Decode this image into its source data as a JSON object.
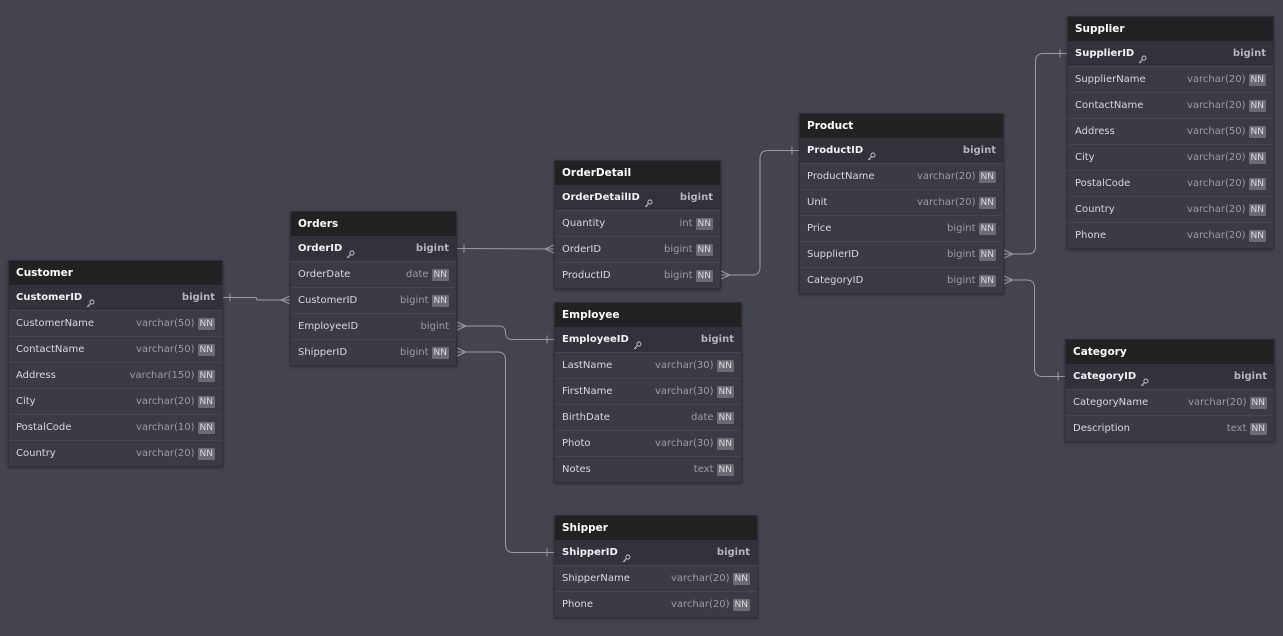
{
  "tables": {
    "customer": {
      "name": "Customer",
      "columns": [
        {
          "name": "CustomerID",
          "type": "bigint",
          "pk": true,
          "nn": false
        },
        {
          "name": "CustomerName",
          "type": "varchar(50)",
          "pk": false,
          "nn": true
        },
        {
          "name": "ContactName",
          "type": "varchar(50)",
          "pk": false,
          "nn": true
        },
        {
          "name": "Address",
          "type": "varchar(150)",
          "pk": false,
          "nn": true
        },
        {
          "name": "City",
          "type": "varchar(20)",
          "pk": false,
          "nn": true
        },
        {
          "name": "PostalCode",
          "type": "varchar(10)",
          "pk": false,
          "nn": true
        },
        {
          "name": "Country",
          "type": "varchar(20)",
          "pk": false,
          "nn": true
        }
      ]
    },
    "orders": {
      "name": "Orders",
      "columns": [
        {
          "name": "OrderID",
          "type": "bigint",
          "pk": true,
          "nn": false
        },
        {
          "name": "OrderDate",
          "type": "date",
          "pk": false,
          "nn": true
        },
        {
          "name": "CustomerID",
          "type": "bigint",
          "pk": false,
          "nn": true
        },
        {
          "name": "EmployeeID",
          "type": "bigint",
          "pk": false,
          "nn": false
        },
        {
          "name": "ShipperID",
          "type": "bigint",
          "pk": false,
          "nn": true
        }
      ]
    },
    "orderdetail": {
      "name": "OrderDetail",
      "columns": [
        {
          "name": "OrderDetailID",
          "type": "bigint",
          "pk": true,
          "nn": false
        },
        {
          "name": "Quantity",
          "type": "int",
          "pk": false,
          "nn": true
        },
        {
          "name": "OrderID",
          "type": "bigint",
          "pk": false,
          "nn": true
        },
        {
          "name": "ProductID",
          "type": "bigint",
          "pk": false,
          "nn": true
        }
      ]
    },
    "employee": {
      "name": "Employee",
      "columns": [
        {
          "name": "EmployeeID",
          "type": "bigint",
          "pk": true,
          "nn": false
        },
        {
          "name": "LastName",
          "type": "varchar(30)",
          "pk": false,
          "nn": true
        },
        {
          "name": "FirstName",
          "type": "varchar(30)",
          "pk": false,
          "nn": true
        },
        {
          "name": "BirthDate",
          "type": "date",
          "pk": false,
          "nn": true
        },
        {
          "name": "Photo",
          "type": "varchar(30)",
          "pk": false,
          "nn": true
        },
        {
          "name": "Notes",
          "type": "text",
          "pk": false,
          "nn": true
        }
      ]
    },
    "shipper": {
      "name": "Shipper",
      "columns": [
        {
          "name": "ShipperID",
          "type": "bigint",
          "pk": true,
          "nn": false
        },
        {
          "name": "ShipperName",
          "type": "varchar(20)",
          "pk": false,
          "nn": true
        },
        {
          "name": "Phone",
          "type": "varchar(20)",
          "pk": false,
          "nn": true
        }
      ]
    },
    "product": {
      "name": "Product",
      "columns": [
        {
          "name": "ProductID",
          "type": "bigint",
          "pk": true,
          "nn": false
        },
        {
          "name": "ProductName",
          "type": "varchar(20)",
          "pk": false,
          "nn": true
        },
        {
          "name": "Unit",
          "type": "varchar(20)",
          "pk": false,
          "nn": true
        },
        {
          "name": "Price",
          "type": "bigint",
          "pk": false,
          "nn": true
        },
        {
          "name": "SupplierID",
          "type": "bigint",
          "pk": false,
          "nn": true
        },
        {
          "name": "CategoryID",
          "type": "bigint",
          "pk": false,
          "nn": true
        }
      ]
    },
    "supplier": {
      "name": "Supplier",
      "columns": [
        {
          "name": "SupplierID",
          "type": "bigint",
          "pk": true,
          "nn": false
        },
        {
          "name": "SupplierName",
          "type": "varchar(20)",
          "pk": false,
          "nn": true
        },
        {
          "name": "ContactName",
          "type": "varchar(20)",
          "pk": false,
          "nn": true
        },
        {
          "name": "Address",
          "type": "varchar(50)",
          "pk": false,
          "nn": true
        },
        {
          "name": "City",
          "type": "varchar(20)",
          "pk": false,
          "nn": true
        },
        {
          "name": "PostalCode",
          "type": "varchar(20)",
          "pk": false,
          "nn": true
        },
        {
          "name": "Country",
          "type": "varchar(20)",
          "pk": false,
          "nn": true
        },
        {
          "name": "Phone",
          "type": "varchar(20)",
          "pk": false,
          "nn": true
        }
      ]
    },
    "category": {
      "name": "Category",
      "columns": [
        {
          "name": "CategoryID",
          "type": "bigint",
          "pk": true,
          "nn": false
        },
        {
          "name": "CategoryName",
          "type": "varchar(20)",
          "pk": false,
          "nn": true
        },
        {
          "name": "Description",
          "type": "text",
          "pk": false,
          "nn": true
        }
      ]
    }
  },
  "nn_label": "NN",
  "relationships": [
    {
      "from_table": "orders",
      "from_col": "CustomerID",
      "to_table": "customer",
      "to_col": "CustomerID",
      "cardinality": "many-to-one"
    },
    {
      "from_table": "orderdetail",
      "from_col": "OrderID",
      "to_table": "orders",
      "to_col": "OrderID",
      "cardinality": "many-to-one"
    },
    {
      "from_table": "orders",
      "from_col": "EmployeeID",
      "to_table": "employee",
      "to_col": "EmployeeID",
      "cardinality": "many-to-one"
    },
    {
      "from_table": "orders",
      "from_col": "ShipperID",
      "to_table": "shipper",
      "to_col": "ShipperID",
      "cardinality": "many-to-one"
    },
    {
      "from_table": "orderdetail",
      "from_col": "ProductID",
      "to_table": "product",
      "to_col": "ProductID",
      "cardinality": "many-to-one"
    },
    {
      "from_table": "product",
      "from_col": "SupplierID",
      "to_table": "supplier",
      "to_col": "SupplierID",
      "cardinality": "many-to-one"
    },
    {
      "from_table": "product",
      "from_col": "CategoryID",
      "to_table": "category",
      "to_col": "CategoryID",
      "cardinality": "many-to-one"
    }
  ],
  "colors": {
    "canvas": "#44444f",
    "table_header": "#222224",
    "table_body": "#3a3b44",
    "link": "#9a9ba5",
    "nn_badge": "#6a6b73"
  }
}
